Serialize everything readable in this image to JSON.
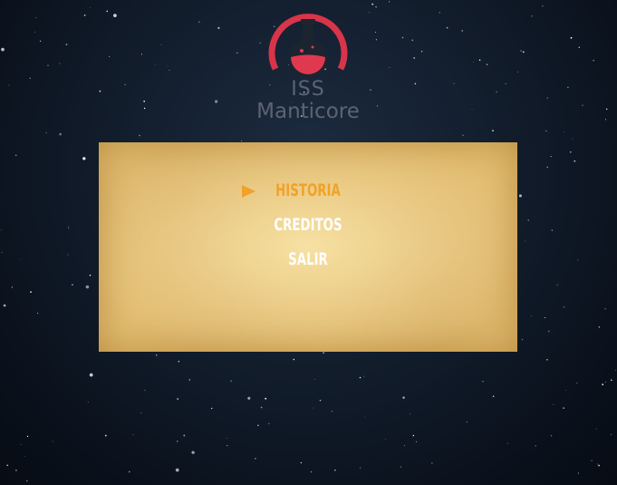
{
  "logo": {
    "line1": "ISS",
    "line2": "Manticore",
    "ring_color": "#d8344a",
    "liquid_color": "#e0394f",
    "flask_color": "#1c2430"
  },
  "menu": {
    "items": [
      {
        "label": "HISTORIA",
        "selected": true
      },
      {
        "label": "CREDITOS",
        "selected": false
      },
      {
        "label": "SALIR",
        "selected": false
      }
    ],
    "selected_color": "#f0a229",
    "normal_color": "#ffffff",
    "selector_icon": "triangle-right-icon"
  }
}
